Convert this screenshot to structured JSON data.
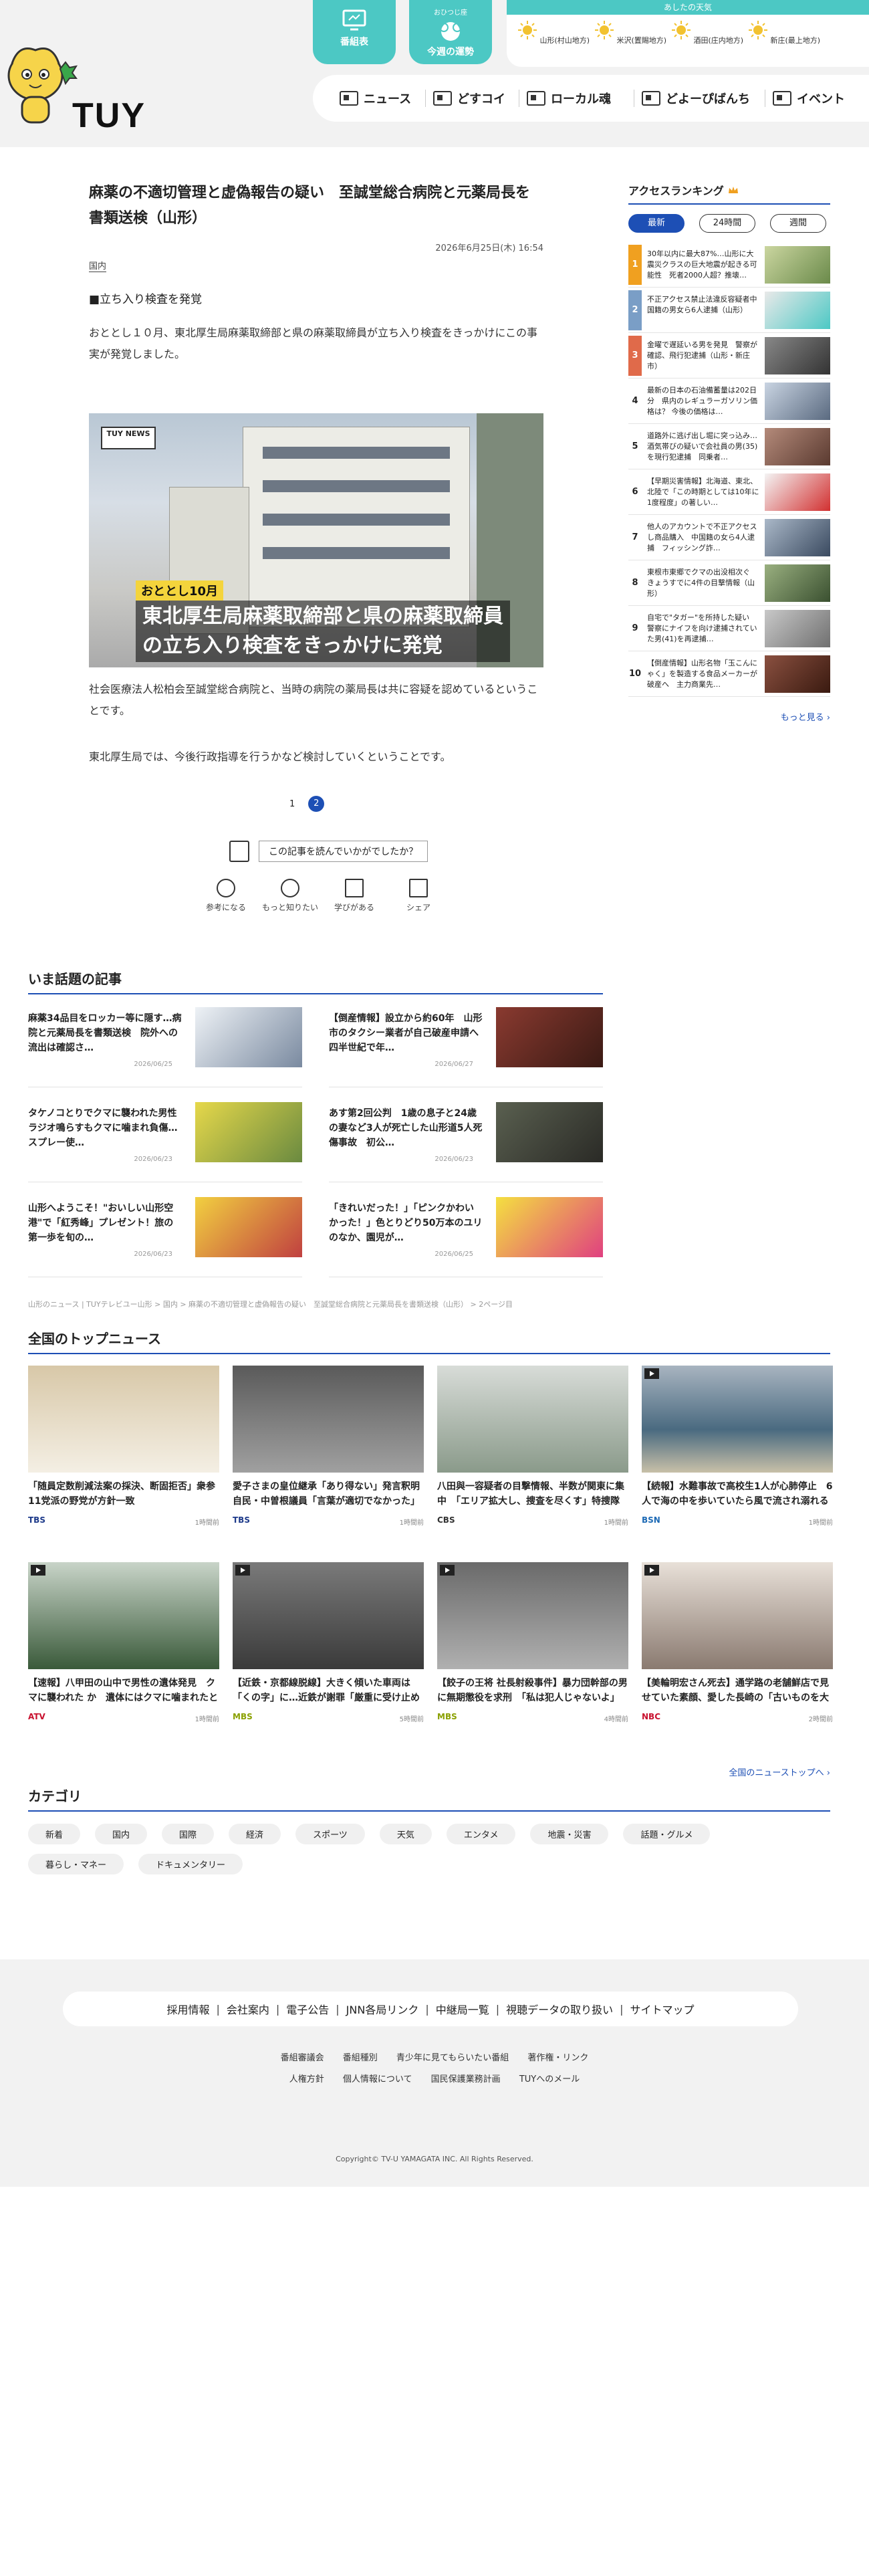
{
  "header": {
    "logo": "TUY",
    "buttons": [
      {
        "label": "番組表",
        "sub": ""
      },
      {
        "label": "今週の運勢",
        "sub": "おひつじ座"
      }
    ],
    "weather": {
      "title": "あしたの天気",
      "areas": [
        "山形(村山地方)",
        "米沢(置賜地方)",
        "酒田(庄内地方)",
        "新庄(最上地方)"
      ],
      "color": "#f2c230"
    },
    "nav": [
      "ニュース",
      "どすコイ",
      "ローカル魂",
      "どよーぴばんち",
      "イベント"
    ]
  },
  "article": {
    "title": "麻薬の不適切管理と虚偽報告の疑い　至誠堂総合病院と元薬局長を書類送検（山形）",
    "date": "2026年6月25日(木) 16:54",
    "category": "国内",
    "lead": "■立ち入り検査を発覚",
    "para1": "おととし１０月、東北厚生局麻薬取締部と県の麻薬取締員が立ち入り検査をきっかけにこの事実が発覚しました。",
    "photo_tag": "TUY NEWS",
    "photo_caption_small": "おととし10月",
    "photo_caption_big": "東北厚生局麻薬取締部と県の麻薬取締員の立ち入り検査をきっかけに発覚",
    "para2": "社会医療法人松柏会至誠堂総合病院と、当時の病院の薬局長は共に容疑を認めているということです。",
    "para3": "東北厚生局では、今後行政指導を行うかなど検討していくということです。",
    "pages": [
      "1",
      "2"
    ],
    "feedback_label": "この記事を読んでいかがでしたか？",
    "reactions": [
      "参考になる",
      "もっと知りたい",
      "学びがある",
      "シェア"
    ]
  },
  "ranking": {
    "title": "アクセスランキング",
    "tabs": [
      "最新",
      "24時間",
      "週間"
    ],
    "items": [
      {
        "num": "1",
        "text": "30年以内に最大87%…山形に大震災クラスの巨大地震が起きる可能性　死者2000人超？推壊…",
        "color": "#f0a020"
      },
      {
        "num": "2",
        "text": "不正アクセス禁止法違反容疑者中国籍の男女ら6人逮捕（山形）",
        "color": "#7a9ec6"
      },
      {
        "num": "3",
        "text": "金曜で遅延いる男を発見　警察が確認、飛行犯逮捕（山形・新庄市）",
        "color": "#e06a4a"
      },
      {
        "num": "4",
        "text": "最新の日本の石油備蓄量は202日分　県内のレギュラーガソリン価格は？ 今後の価格は…",
        "color": ""
      },
      {
        "num": "5",
        "text": "道路外に逃げ出し堀に突っ込み…酒気帯びの疑いで会社員の男(35)を現行犯逮捕　同乗者…",
        "color": ""
      },
      {
        "num": "6",
        "text": "【早期災害情報】北海道、東北、北陸で「この時期としては10年に1度程度」の著しい…",
        "color": ""
      },
      {
        "num": "7",
        "text": "他人のアカウントで不正アクセスし商品購入　中国籍の女ら4人逮捕　フィッシング詐…",
        "color": ""
      },
      {
        "num": "8",
        "text": "東根市東郷でクマの出没相次ぐ　きょうすでに4件の目撃情報（山形）",
        "color": ""
      },
      {
        "num": "9",
        "text": "自宅で\"タガー\"を所持した疑い　警察にナイフを向け逮捕されていた男(41)を再逮捕…",
        "color": ""
      },
      {
        "num": "10",
        "text": "【倒産情報】山形名物「玉こんにゃく」を製造する食品メーカーが破産へ　主力商業先…",
        "color": ""
      }
    ],
    "more": "もっと見る ›"
  },
  "trending": {
    "title": "いま話題の記事",
    "items": [
      {
        "text": "麻薬34品目をロッカー等に隠す…病院と元薬局長を書類送検　院外への流出は確認さ…",
        "date": "2026/06/25"
      },
      {
        "text": "【倒産情報】設立から約60年　山形市のタクシー業者が自己破産申請へ　四半世紀で年…",
        "date": "2026/06/27"
      },
      {
        "text": "タケノコとりでクマに襲われた男性　ラジオ鳴らすもクマに噛まれ負傷…スプレー使…",
        "date": "2026/06/23"
      },
      {
        "text": "あす第2回公判　1歳の息子と24歳の妻など3人が死亡した山形道5人死傷事故　初公…",
        "date": "2026/06/23"
      },
      {
        "text": "山形へようこそ！\"おいしい山形空港\"で「紅秀峰」プレゼント！旅の第一歩を旬の…",
        "date": "2026/06/23"
      },
      {
        "text": "「きれいだった！」「ピンクかわいかった！」色とりどり50万本のユリのなか、園児が…",
        "date": "2026/06/25"
      }
    ]
  },
  "breadcrumb": "山形のニュース | TUYテレビユー山形 > 国内 > 麻薬の不適切管理と虚偽報告の疑い　至誠堂総合病院と元薬局長を書類送検（山形） > 2ページ目",
  "topnews": {
    "title": "全国のトップニュース",
    "items": [
      {
        "text": "「随員定数削減法案の採決、断固拒否」衆参11党派の野党が方針一致",
        "src": "TBS",
        "time": "1時間前",
        "src_color": "#1d3a8a"
      },
      {
        "text": "愛子さまの皇位継承「あり得ない」発言釈明　自民・中曽根議員「言葉が適切でなかった」反省」「幸せを願って…",
        "src": "TBS",
        "time": "1時間前",
        "src_color": "#1d3a8a"
      },
      {
        "text": "八田與一容疑者の目撃情報、半数が関東に集中　「エリア拡大し、捜査を尽くす」特捜隊長が誓う逮捕への執念　…",
        "src": "CBS",
        "time": "1時間前",
        "src_color": "#333333"
      },
      {
        "text": "【続報】水難事故で高校生1人が心肺停止　6人で海の中を歩いていたら風で流され溺れる　新潟市西区",
        "src": "BSN",
        "time": "1時間前",
        "src_color": "#1d6ab5"
      },
      {
        "text": "【速報】八甲田の山中で男性の遺体発見　クマに襲われた か　遺体にはクマに噛まれたとみられる傷　付近では…",
        "src": "ATV",
        "time": "1時間前",
        "src_color": "#c8102e"
      },
      {
        "text": "【近鉄・京都線脱線】大きく傾いた車両は「くの字」に…近鉄が謝罪「厳重に受け止め　一刻も早く原因究明」…",
        "src": "MBS",
        "time": "5時間前",
        "src_color": "#8aa000"
      },
      {
        "text": "【餃子の王将 社長射殺事件】暴力団幹部の男に無期懲役を求刑　「私は犯人じゃないよ」被告は無罪を主張…",
        "src": "MBS",
        "time": "4時間前",
        "src_color": "#8aa000"
      },
      {
        "text": "【美輪明宏さん死去】通学路の老舗鮮店で見せていた素顔、愛した長崎の「古いものを大事に」という遺志　…",
        "src": "NBC",
        "time": "2時間前",
        "src_color": "#c8102e"
      }
    ],
    "more": "全国のニューストップへ ›"
  },
  "category": {
    "title": "カテゴリ",
    "items": [
      "新着",
      "国内",
      "国際",
      "経済",
      "スポーツ",
      "天気",
      "エンタメ",
      "地震・災害",
      "話題・グルメ",
      "暮らし・マネー",
      "ドキュメンタリー"
    ]
  },
  "footer": {
    "links": [
      "採用情報",
      "会社案内",
      "電子公告",
      "JNN各局リンク",
      "中継局一覧",
      "視聴データの取り扱い",
      "サイトマップ"
    ],
    "row1": [
      "番組審議会",
      "番組種別",
      "青少年に見てもらいたい番組",
      "著作権・リンク"
    ],
    "row2": [
      "人権方針",
      "個人情報について",
      "国民保護業務計画",
      "TUYへのメール"
    ],
    "copyright": "Copyright© TV-U YAMAGATA INC. All Rights Reserved."
  }
}
